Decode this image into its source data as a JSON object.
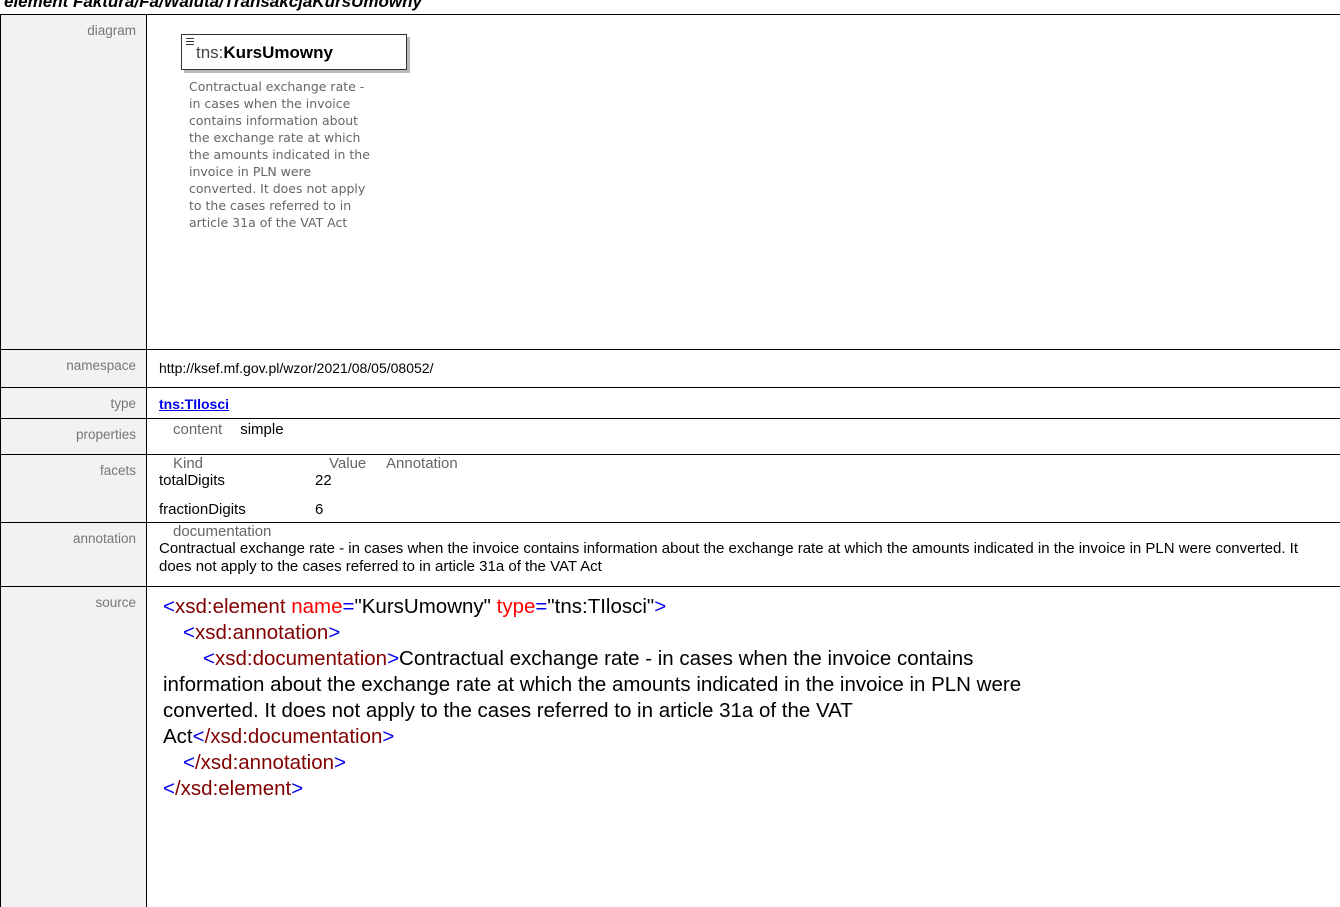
{
  "heading": "element Faktura/Fa/Waluta/TransakcjaKursUmowny",
  "rows": {
    "diagram": "diagram",
    "namespace": "namespace",
    "type": "type",
    "properties": "properties",
    "facets": "facets",
    "annotation": "annotation",
    "source": "source"
  },
  "diagram": {
    "prefix": "tns:",
    "name": "KursUmowny",
    "doc": "Contractual exchange rate -\nin cases when the invoice\ncontains information about\nthe exchange rate at which\nthe amounts indicated in the\ninvoice in PLN were\nconverted. It does not apply\nto the cases referred to in\narticle 31a of the VAT Act",
    "icon": "element-lines-icon"
  },
  "namespace": "http://ksef.mf.gov.pl/wzor/2021/08/05/08052/",
  "type_link": "tns:TIlosci",
  "properties": {
    "key": "content",
    "value": "simple"
  },
  "facets": {
    "headers": [
      "Kind",
      "Value",
      "Annotation"
    ],
    "rows": [
      {
        "kind": "totalDigits",
        "value": "22"
      },
      {
        "kind": "fractionDigits",
        "value": "6"
      }
    ]
  },
  "annotation": {
    "label": "documentation",
    "text": "Contractual exchange rate - in cases when the invoice contains information about the exchange rate at which the amounts indicated in the invoice in PLN were converted. It does not apply to the cases referred to in article 31a of the VAT Act"
  },
  "source": {
    "elem_open": "xsd:element",
    "attr_name": "name",
    "val_name": "\"KursUmowny\"",
    "attr_type": "type",
    "val_type": "\"tns:TIlosci\"",
    "annotation_tag": "xsd:annotation",
    "doc_tag": "xsd:documentation",
    "doc_text_1": "Contractual exchange rate - in cases when the invoice contains",
    "doc_text_2": "information about the exchange rate at which the amounts indicated in the invoice in PLN were",
    "doc_text_3": "converted. It does not apply to the cases referred to in article 31a of the VAT",
    "doc_text_4": "Act",
    "doc_close": "/xsd:documentation",
    "annotation_close": "/xsd:annotation",
    "elem_close": "/xsd:element"
  },
  "colors": {
    "tag": "#800000",
    "bracket": "#0000ee",
    "attr": "#ff0000",
    "label_bg": "#f2f2f2",
    "link": "#0000ee"
  }
}
